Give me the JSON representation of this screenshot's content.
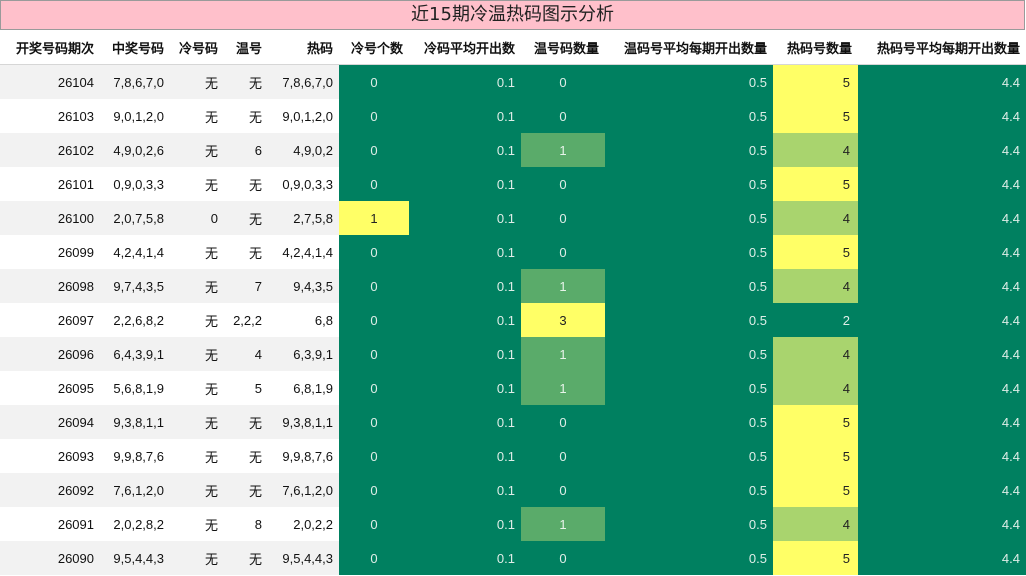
{
  "title": "近15期冷温热码图示分析",
  "colors": {
    "title_bg": "#ffc0cb",
    "base_green": "#008060",
    "highlight_yellow": "#ffff66",
    "medium_green": "#5aab6a",
    "light_green": "#a9d46e"
  },
  "headers": [
    "开奖号码期次",
    "中奖号码",
    "冷号码",
    "温号",
    "热码",
    "冷号个数",
    "冷码平均开出数",
    "温号码数量",
    "温码号平均每期开出数量",
    "热码号数量",
    "热码号平均每期开出数量"
  ],
  "rows": [
    {
      "period": "26104",
      "draw": "7,8,6,7,0",
      "cold": "无",
      "warm": "无",
      "hot": "7,8,6,7,0",
      "cold_count": "0",
      "cold_avg": "0.1",
      "warm_count": "0",
      "warm_avg": "0.5",
      "hot_count": "5",
      "hot_avg": "4.4"
    },
    {
      "period": "26103",
      "draw": "9,0,1,2,0",
      "cold": "无",
      "warm": "无",
      "hot": "9,0,1,2,0",
      "cold_count": "0",
      "cold_avg": "0.1",
      "warm_count": "0",
      "warm_avg": "0.5",
      "hot_count": "5",
      "hot_avg": "4.4"
    },
    {
      "period": "26102",
      "draw": "4,9,0,2,6",
      "cold": "无",
      "warm": "6",
      "hot": "4,9,0,2",
      "cold_count": "0",
      "cold_avg": "0.1",
      "warm_count": "1",
      "warm_avg": "0.5",
      "hot_count": "4",
      "hot_avg": "4.4"
    },
    {
      "period": "26101",
      "draw": "0,9,0,3,3",
      "cold": "无",
      "warm": "无",
      "hot": "0,9,0,3,3",
      "cold_count": "0",
      "cold_avg": "0.1",
      "warm_count": "0",
      "warm_avg": "0.5",
      "hot_count": "5",
      "hot_avg": "4.4"
    },
    {
      "period": "26100",
      "draw": "2,0,7,5,8",
      "cold": "0",
      "warm": "无",
      "hot": "2,7,5,8",
      "cold_count": "1",
      "cold_avg": "0.1",
      "warm_count": "0",
      "warm_avg": "0.5",
      "hot_count": "4",
      "hot_avg": "4.4"
    },
    {
      "period": "26099",
      "draw": "4,2,4,1,4",
      "cold": "无",
      "warm": "无",
      "hot": "4,2,4,1,4",
      "cold_count": "0",
      "cold_avg": "0.1",
      "warm_count": "0",
      "warm_avg": "0.5",
      "hot_count": "5",
      "hot_avg": "4.4"
    },
    {
      "period": "26098",
      "draw": "9,7,4,3,5",
      "cold": "无",
      "warm": "7",
      "hot": "9,4,3,5",
      "cold_count": "0",
      "cold_avg": "0.1",
      "warm_count": "1",
      "warm_avg": "0.5",
      "hot_count": "4",
      "hot_avg": "4.4"
    },
    {
      "period": "26097",
      "draw": "2,2,6,8,2",
      "cold": "无",
      "warm": "2,2,2",
      "hot": "6,8",
      "cold_count": "0",
      "cold_avg": "0.1",
      "warm_count": "3",
      "warm_avg": "0.5",
      "hot_count": "2",
      "hot_avg": "4.4"
    },
    {
      "period": "26096",
      "draw": "6,4,3,9,1",
      "cold": "无",
      "warm": "4",
      "hot": "6,3,9,1",
      "cold_count": "0",
      "cold_avg": "0.1",
      "warm_count": "1",
      "warm_avg": "0.5",
      "hot_count": "4",
      "hot_avg": "4.4"
    },
    {
      "period": "26095",
      "draw": "5,6,8,1,9",
      "cold": "无",
      "warm": "5",
      "hot": "6,8,1,9",
      "cold_count": "0",
      "cold_avg": "0.1",
      "warm_count": "1",
      "warm_avg": "0.5",
      "hot_count": "4",
      "hot_avg": "4.4"
    },
    {
      "period": "26094",
      "draw": "9,3,8,1,1",
      "cold": "无",
      "warm": "无",
      "hot": "9,3,8,1,1",
      "cold_count": "0",
      "cold_avg": "0.1",
      "warm_count": "0",
      "warm_avg": "0.5",
      "hot_count": "5",
      "hot_avg": "4.4"
    },
    {
      "period": "26093",
      "draw": "9,9,8,7,6",
      "cold": "无",
      "warm": "无",
      "hot": "9,9,8,7,6",
      "cold_count": "0",
      "cold_avg": "0.1",
      "warm_count": "0",
      "warm_avg": "0.5",
      "hot_count": "5",
      "hot_avg": "4.4"
    },
    {
      "period": "26092",
      "draw": "7,6,1,2,0",
      "cold": "无",
      "warm": "无",
      "hot": "7,6,1,2,0",
      "cold_count": "0",
      "cold_avg": "0.1",
      "warm_count": "0",
      "warm_avg": "0.5",
      "hot_count": "5",
      "hot_avg": "4.4"
    },
    {
      "period": "26091",
      "draw": "2,0,2,8,2",
      "cold": "无",
      "warm": "8",
      "hot": "2,0,2,2",
      "cold_count": "0",
      "cold_avg": "0.1",
      "warm_count": "1",
      "warm_avg": "0.5",
      "hot_count": "4",
      "hot_avg": "4.4"
    },
    {
      "period": "26090",
      "draw": "9,5,4,4,3",
      "cold": "无",
      "warm": "无",
      "hot": "9,5,4,4,3",
      "cold_count": "0",
      "cold_avg": "0.1",
      "warm_count": "0",
      "warm_avg": "0.5",
      "hot_count": "5",
      "hot_avg": "4.4"
    }
  ]
}
